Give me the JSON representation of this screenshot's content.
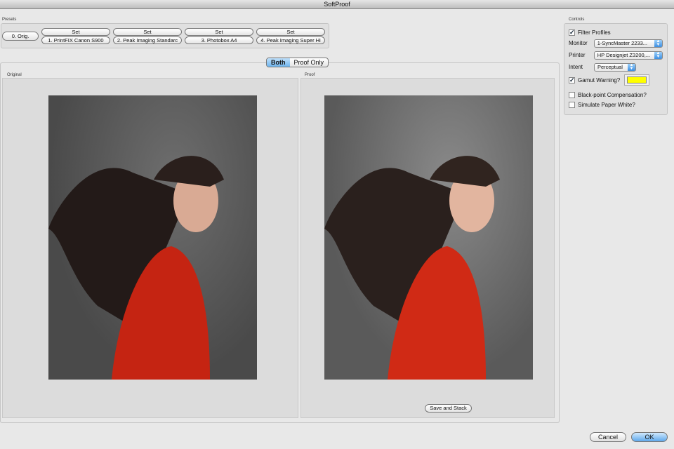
{
  "window": {
    "title": "SoftProof"
  },
  "presets": {
    "label": "Presets",
    "orig_label": "0. Orig.",
    "items": [
      {
        "set_label": "Set",
        "name": "1. PrintFIX Canon S900"
      },
      {
        "set_label": "Set",
        "name": "2. Peak Imaging Standarc"
      },
      {
        "set_label": "Set",
        "name": "3. Photobox A4"
      },
      {
        "set_label": "Set",
        "name": "4. Peak Imaging Super Hi"
      }
    ]
  },
  "view_mode": {
    "options": [
      "Both",
      "Proof Only"
    ],
    "selected": "Both"
  },
  "original": {
    "label": "Original"
  },
  "proof": {
    "label": "Proof",
    "save_label": "Save and Stack"
  },
  "controls": {
    "label": "Controls",
    "filter_profiles": {
      "label": "Filter Profiles",
      "checked": true
    },
    "monitor": {
      "label": "Monitor",
      "value": "1-SyncMaster 2233..."
    },
    "printer": {
      "label": "Printer",
      "value": "HP Designjet Z3200,..."
    },
    "intent": {
      "label": "Intent",
      "value": "Perceptual"
    },
    "gamut_warning": {
      "label": "Gamut Warning?",
      "checked": true,
      "color": "#ffff00"
    },
    "black_point": {
      "label": "Black-point Compensation?",
      "checked": false
    },
    "paper_white": {
      "label": "Simulate Paper White?",
      "checked": false
    }
  },
  "footer": {
    "cancel_label": "Cancel",
    "ok_label": "OK"
  }
}
